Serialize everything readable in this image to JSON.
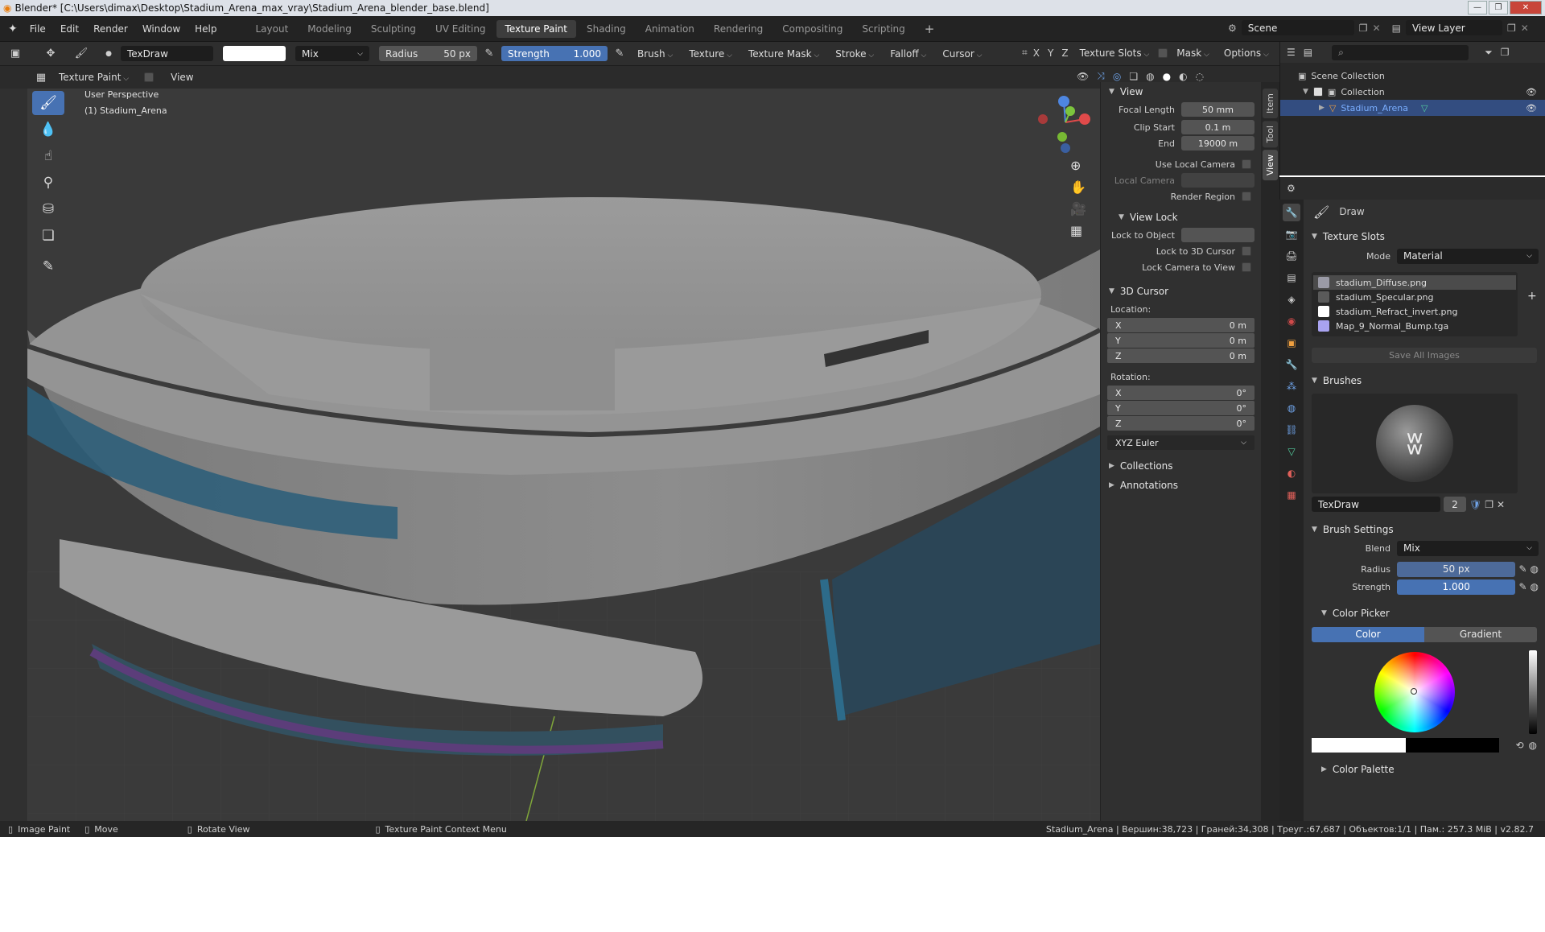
{
  "window": {
    "title": "Blender* [C:\\Users\\dimax\\Desktop\\Stadium_Arena_max_vray\\Stadium_Arena_blender_base.blend]"
  },
  "menu": [
    "File",
    "Edit",
    "Render",
    "Window",
    "Help"
  ],
  "workspaces": [
    "Layout",
    "Modeling",
    "Sculpting",
    "UV Editing",
    "Texture Paint",
    "Shading",
    "Animation",
    "Rendering",
    "Compositing",
    "Scripting"
  ],
  "active_workspace": "Texture Paint",
  "scene_name": "Scene",
  "view_layer": "View Layer",
  "tool_header": {
    "brush_name": "TexDraw",
    "blend_mode": "Mix",
    "radius_label": "Radius",
    "radius_value": "50 px",
    "strength_label": "Strength",
    "strength_value": "1.000",
    "menus": [
      "Brush",
      "Texture",
      "Texture Mask",
      "Stroke",
      "Falloff",
      "Cursor"
    ],
    "axes": [
      "X",
      "Y",
      "Z"
    ],
    "texture_slots": "Texture Slots",
    "mask": "Mask",
    "options": "Options"
  },
  "view_header": {
    "mode": "Texture Paint",
    "view_menu": "View"
  },
  "viewport": {
    "perspective": "User Perspective",
    "object_label": "(1) Stadium_Arena"
  },
  "npanel": {
    "tabs": [
      "Item",
      "Tool",
      "View"
    ],
    "view_section": "View",
    "focal_length_label": "Focal Length",
    "focal_length": "50 mm",
    "clip_start_label": "Clip Start",
    "clip_start": "0.1 m",
    "end_label": "End",
    "clip_end": "19000 m",
    "use_local_camera": "Use Local Camera",
    "local_camera": "Local Camera",
    "render_region": "Render Region",
    "view_lock_section": "View Lock",
    "lock_to_object": "Lock to Object",
    "lock_to_cursor": "Lock to 3D Cursor",
    "lock_camera": "Lock Camera to View",
    "cursor_section": "3D Cursor",
    "location_label": "Location:",
    "location": [
      {
        "axis": "X",
        "value": "0 m"
      },
      {
        "axis": "Y",
        "value": "0 m"
      },
      {
        "axis": "Z",
        "value": "0 m"
      }
    ],
    "rotation_label": "Rotation:",
    "rotation": [
      {
        "axis": "X",
        "value": "0°"
      },
      {
        "axis": "Y",
        "value": "0°"
      },
      {
        "axis": "Z",
        "value": "0°"
      }
    ],
    "rotation_mode": "XYZ Euler",
    "collections": "Collections",
    "annotations": "Annotations"
  },
  "outliner": {
    "scene_collection": "Scene Collection",
    "collection": "Collection",
    "object": "Stadium_Arena"
  },
  "properties": {
    "draw_label": "Draw",
    "texture_slots_section": "Texture Slots",
    "mode_label": "Mode",
    "mode_value": "Material",
    "slots": [
      {
        "name": "stadium_Diffuse.png",
        "swatch": "#9a9aa6"
      },
      {
        "name": "stadium_Specular.png",
        "swatch": "#5a5a5a"
      },
      {
        "name": "stadium_Refract_invert.png",
        "swatch": "#ffffff"
      },
      {
        "name": "Map_9_Normal_Bump.tga",
        "swatch": "#a9a3f0"
      }
    ],
    "save_all": "Save All Images",
    "brushes_section": "Brushes",
    "brush_name": "TexDraw",
    "brush_users": "2",
    "brush_settings_section": "Brush Settings",
    "blend_label": "Blend",
    "blend_value": "Mix",
    "radius_label": "Radius",
    "radius_value": "50 px",
    "strength_label": "Strength",
    "strength_value": "1.000",
    "color_picker_section": "Color Picker",
    "color_tab": "Color",
    "gradient_tab": "Gradient",
    "color_palette": "Color Palette"
  },
  "status": {
    "left_items": [
      "Image Paint",
      "Move",
      "Rotate View",
      "Texture Paint Context Menu"
    ],
    "right": "Stadium_Arena | Вершин:38,723 | Граней:34,308 | Треуг.:67,687 | Объектов:1/1 | Пам.: 257.3 MiB | v2.82.7"
  },
  "colors": {
    "accent": "#4772b3",
    "header_bg": "#232323",
    "panel_bg": "#303030"
  }
}
